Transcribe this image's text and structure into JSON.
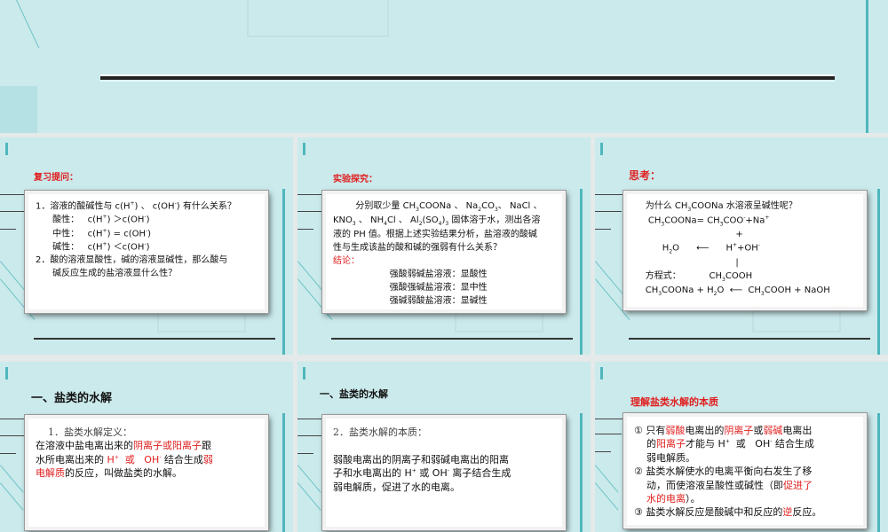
{
  "slides": [
    {
      "id": "review",
      "title": "复习提问：",
      "lines": [
        [
          {
            "t": "1．溶液的酸碱性与 c(H"
          },
          {
            "t": "+",
            "sup": 1
          },
          {
            "t": ") 、 c(OH"
          },
          {
            "t": "-",
            "sup": 1
          },
          {
            "t": ") 有什么关系？"
          }
        ],
        [
          {
            "t": "      酸性：   c(H"
          },
          {
            "t": "+",
            "sup": 1
          },
          {
            "t": ") ＞c(OH"
          },
          {
            "t": "-",
            "sup": 1
          },
          {
            "t": ")"
          }
        ],
        [
          {
            "t": "      中性：   c(H"
          },
          {
            "t": "+",
            "sup": 1
          },
          {
            "t": ") = c(OH"
          },
          {
            "t": "-",
            "sup": 1
          },
          {
            "t": ")"
          }
        ],
        [
          {
            "t": "      碱性：   c(H"
          },
          {
            "t": "+",
            "sup": 1
          },
          {
            "t": ") ＜c(OH"
          },
          {
            "t": "-",
            "sup": 1
          },
          {
            "t": ")"
          }
        ],
        [
          {
            "t": "2．酸的溶液显酸性，碱的溶液显碱性，那么酸与"
          }
        ],
        [
          {
            "t": "      碱反应生成的盐溶液显什么性？"
          }
        ]
      ]
    },
    {
      "id": "experiment",
      "title": "实验探究：",
      "lines": [
        [
          {
            "t": "        分别取少量 CH"
          },
          {
            "t": "3",
            "sub": 1
          },
          {
            "t": "COONa 、 Na"
          },
          {
            "t": "2",
            "sub": 1
          },
          {
            "t": "CO"
          },
          {
            "t": "3",
            "sub": 1
          },
          {
            "t": "、 NaCl 、"
          }
        ],
        [
          {
            "t": "KNO"
          },
          {
            "t": "3",
            "sub": 1
          },
          {
            "t": " 、 NH"
          },
          {
            "t": "4",
            "sub": 1
          },
          {
            "t": "Cl 、 Al"
          },
          {
            "t": "2",
            "sub": 1
          },
          {
            "t": "(SO"
          },
          {
            "t": "4",
            "sub": 1
          },
          {
            "t": ")"
          },
          {
            "t": "3",
            "sub": 1
          },
          {
            "t": " 固体溶于水，测出各溶"
          }
        ],
        [
          {
            "t": "液的 PH 值。根据上述实验结果分析，盐溶液的酸碱"
          }
        ],
        [
          {
            "t": "性与生成该盐的酸和碱的强弱有什么关系？"
          }
        ],
        [
          {
            "t": "结论：",
            "red": 1
          }
        ],
        [
          {
            "t": "                    强酸弱碱盐溶液：显酸性"
          }
        ],
        [
          {
            "t": "                    强酸强碱盐溶液：显中性"
          }
        ],
        [
          {
            "t": "                    强碱弱酸盐溶液：显碱性"
          }
        ]
      ]
    },
    {
      "id": "think",
      "title": "思考：",
      "lines": [
        [
          {
            "t": "    为什么 CH"
          },
          {
            "t": "3",
            "sub": 1
          },
          {
            "t": "COONa 水溶液呈碱性呢？"
          }
        ],
        [
          {
            "t": "     CH"
          },
          {
            "t": "3",
            "sub": 1
          },
          {
            "t": "COONa= CH"
          },
          {
            "t": "3",
            "sub": 1
          },
          {
            "t": "COO"
          },
          {
            "t": "-",
            "sup": 1
          },
          {
            "t": "+Na"
          },
          {
            "t": "+",
            "sup": 1
          }
        ],
        [
          {
            "t": "                                    +"
          }
        ],
        [
          {
            "t": "          H"
          },
          {
            "t": "2",
            "sub": 1
          },
          {
            "t": "O      ⟵      H"
          },
          {
            "t": "+",
            "sup": 1
          },
          {
            "t": "+OH"
          },
          {
            "t": "-",
            "sup": 1
          }
        ],
        [
          {
            "t": "                                    |"
          }
        ],
        [
          {
            "t": "    方程式：          CH"
          },
          {
            "t": "3",
            "sub": 1
          },
          {
            "t": "COOH"
          }
        ],
        [
          {
            "t": "    CH"
          },
          {
            "t": "3",
            "sub": 1
          },
          {
            "t": "COONa + H"
          },
          {
            "t": "2",
            "sub": 1
          },
          {
            "t": "O  ⟵  CH"
          },
          {
            "t": "3",
            "sub": 1
          },
          {
            "t": "COOH + NaOH"
          }
        ]
      ]
    },
    {
      "id": "definition",
      "title": "一、盐类的水解",
      "lines": [
        [
          {
            "t": "    1．盐类水解定义：",
            "serif": 1
          }
        ],
        [
          {
            "t": "在溶液中盐电离出来的"
          },
          {
            "t": "阴离子或阳离子",
            "red": 1
          },
          {
            "t": "跟"
          }
        ],
        [
          {
            "t": "水所电离出来的 "
          },
          {
            "t": "H",
            "red": 1
          },
          {
            "t": "+",
            "sup": 1,
            "red": 1
          },
          {
            "t": "  或   ",
            "red": 1
          },
          {
            "t": "OH",
            "red": 1
          },
          {
            "t": "-",
            "sup": 1,
            "red": 1
          },
          {
            "t": " 结合生成"
          },
          {
            "t": "弱",
            "red": 1
          }
        ],
        [
          {
            "t": "电解质",
            "red": 1
          },
          {
            "t": "的反应，叫做盐类的水解。"
          }
        ]
      ]
    },
    {
      "id": "essence",
      "title": "一、盐类的水解",
      "lines": [
        [
          {
            "t": "2．盐类水解的本质：",
            "serif": 1
          }
        ],
        [
          {
            "t": " "
          }
        ],
        [
          {
            "t": "弱酸电离出的阴离子和弱碱电离出的阳离"
          }
        ],
        [
          {
            "t": "子和水电离出的 H"
          },
          {
            "t": "+",
            "sup": 1
          },
          {
            "t": " 或 OH"
          },
          {
            "t": "-",
            "sup": 1
          },
          {
            "t": " 离子结合生成"
          }
        ],
        [
          {
            "t": "弱电解质，促进了水的电离。"
          }
        ]
      ]
    },
    {
      "id": "understand",
      "title": "理解盐类水解的本质",
      "lines": [
        [
          {
            "t": "① 只有"
          },
          {
            "t": "弱酸",
            "red": 1
          },
          {
            "t": "电离出的"
          },
          {
            "t": "阴离子",
            "red": 1
          },
          {
            "t": "或"
          },
          {
            "t": "弱碱",
            "red": 1
          },
          {
            "t": "电离出"
          }
        ],
        [
          {
            "t": "    的"
          },
          {
            "t": "阳离子",
            "red": 1
          },
          {
            "t": "才能与 H"
          },
          {
            "t": "+",
            "sup": 1
          },
          {
            "t": "  或   OH"
          },
          {
            "t": "-",
            "sup": 1
          },
          {
            "t": " 结合生成"
          }
        ],
        [
          {
            "t": "    弱电解质。"
          }
        ],
        [
          {
            "t": "② 盐类水解使水的电离平衡向右发生了移"
          }
        ],
        [
          {
            "t": "    动，而使溶液呈酸性或碱性（即"
          },
          {
            "t": "促进了",
            "red": 1
          }
        ],
        [
          {
            "t": "    水的电离",
            "red": 1
          },
          {
            "t": "）。"
          }
        ],
        [
          {
            "t": "③ 盐类水解反应是酸碱中和反应的"
          },
          {
            "t": "逆",
            "red": 1
          },
          {
            "t": "反应。"
          }
        ]
      ]
    }
  ]
}
